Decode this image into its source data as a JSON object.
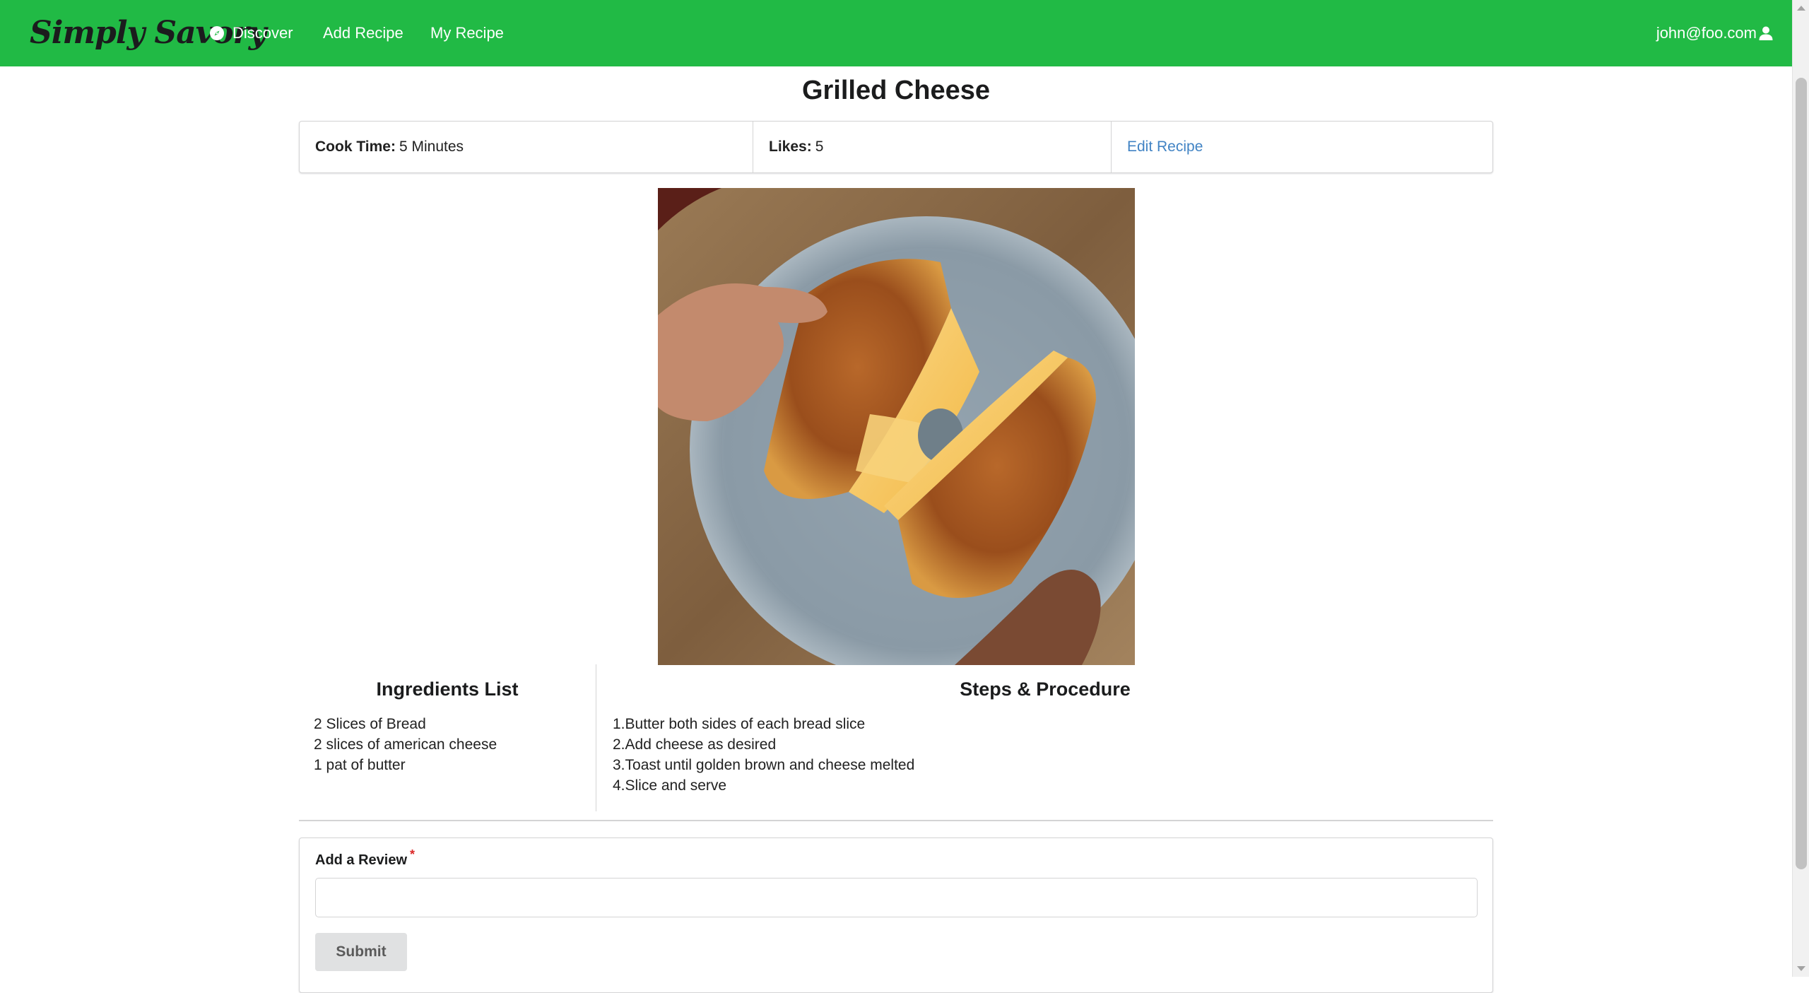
{
  "nav": {
    "brand": "Simply Savory",
    "discover": "Discover",
    "add_recipe": "Add Recipe",
    "my_recipe": "My Recipe",
    "user_email": "john@foo.com",
    "background_color": "#21ba45",
    "icons": {
      "discover": "compass-icon",
      "user": "user-icon"
    }
  },
  "recipe": {
    "title": "Grilled Cheese",
    "cook_time_label": "Cook Time:",
    "cook_time_value": "5 Minutes",
    "likes_label": "Likes:",
    "likes_value": "5",
    "edit_link": "Edit Recipe",
    "image_alt": "Grilled Cheese"
  },
  "ingredients": {
    "heading": "Ingredients List",
    "items": [
      "2 Slices of Bread",
      "2 slices of american cheese",
      "1 pat of butter"
    ]
  },
  "steps": {
    "heading": "Steps & Procedure",
    "items": [
      "1.Butter both sides of each bread slice",
      "2.Add cheese as desired",
      "3.Toast until golden brown and cheese melted",
      "4.Slice and serve"
    ]
  },
  "review": {
    "label": "Add a Review",
    "required_marker": "*",
    "input_value": "",
    "submit_label": "Submit"
  },
  "colors": {
    "accent": "#21ba45",
    "link": "#4183c4",
    "required": "#db2828"
  }
}
